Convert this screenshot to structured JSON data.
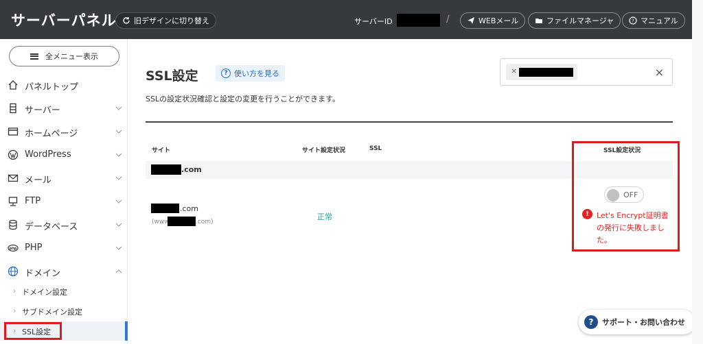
{
  "header": {
    "title": "サーバーパネル",
    "old_design_label": "旧デザインに切り替え",
    "server_id_label": "サーバーID",
    "separator": "/",
    "web_mail_label": "WEBメール",
    "file_manager_label": "ファイルマネージャ",
    "manual_label": "マニュアル"
  },
  "sidebar": {
    "menu_button": "全メニュー表示",
    "items": [
      {
        "label": "パネルトップ",
        "icon": "home-icon",
        "chevron": ""
      },
      {
        "label": "サーバー",
        "icon": "server-icon",
        "chevron": "down"
      },
      {
        "label": "ホームページ",
        "icon": "window-icon",
        "chevron": "down"
      },
      {
        "label": "WordPress",
        "icon": "wordpress-icon",
        "chevron": "down"
      },
      {
        "label": "メール",
        "icon": "mail-icon",
        "chevron": "down"
      },
      {
        "label": "FTP",
        "icon": "ftp-icon",
        "chevron": "down"
      },
      {
        "label": "データベース",
        "icon": "database-icon",
        "chevron": "down"
      },
      {
        "label": "PHP",
        "icon": "php-icon",
        "chevron": "down"
      },
      {
        "label": "ドメイン",
        "icon": "globe-icon",
        "chevron": "up"
      }
    ],
    "sub_items": [
      {
        "label": "ドメイン設定",
        "active": false
      },
      {
        "label": "サブドメイン設定",
        "active": false
      },
      {
        "label": "SSL設定",
        "active": true
      }
    ],
    "sub_arrow": "›"
  },
  "main": {
    "title": "SSL設定",
    "howto_label": "使い方を見る",
    "description": "SSLの設定状況確認と設定の変更を行うことができます。",
    "search": {
      "chip_remove": "×",
      "clear": "×"
    },
    "table": {
      "headers": {
        "site": "サイト",
        "site_status": "サイト設定状況",
        "ssl": "SSL",
        "ssl_status": "SSL設定状況"
      },
      "group_domain_suffix": ".com",
      "row": {
        "domain_suffix": ".com",
        "www_prefix": "(www.",
        "www_suffix": ".com)",
        "site_status": "正常",
        "toggle_label": "OFF",
        "error_lines": [
          "Let's Encrypt証明書",
          "の発行に失敗しまし",
          "た。"
        ]
      }
    }
  },
  "support": {
    "label": "サポート・お問い合わせ"
  },
  "colors": {
    "header_bg": "#373a3d",
    "error": "#e02424",
    "accent": "#2a7ad5",
    "ok": "#2a9d8f",
    "highlight": "#e01a1a"
  }
}
